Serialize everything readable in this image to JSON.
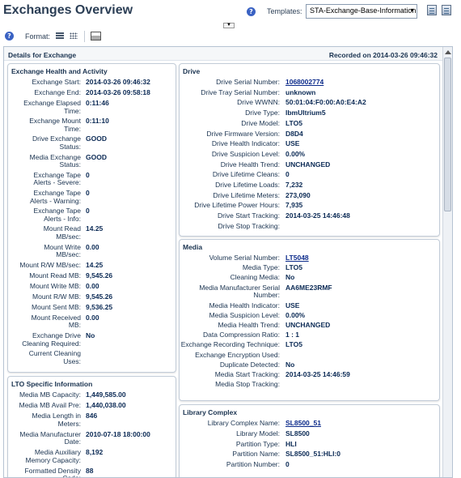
{
  "header": {
    "title": "Exchanges Overview",
    "templates_label": "Templates:",
    "template_value": "STA-Exchange-Base-Information",
    "help_glyph": "?"
  },
  "toolbar": {
    "format_label": "Format:"
  },
  "details": {
    "title": "Details for Exchange",
    "recorded": "Recorded on 2014-03-26 09:46:32"
  },
  "health": {
    "title": "Exchange Health and Activity",
    "rows": [
      {
        "label": [
          "Exchange Start:"
        ],
        "value": "2014-03-26 09:46:32"
      },
      {
        "label": [
          "Exchange End:"
        ],
        "value": "2014-03-26 09:58:18"
      },
      {
        "label": [
          "Exchange Elapsed",
          "Time:"
        ],
        "value": "0:11:46"
      },
      {
        "label": [
          "Exchange Mount",
          "Time:"
        ],
        "value": "0:11:10"
      },
      {
        "label": [
          "Drive Exchange",
          "Status:"
        ],
        "value": "GOOD"
      },
      {
        "label": [
          "Media Exchange",
          "Status:"
        ],
        "value": "GOOD"
      },
      {
        "label": [
          "Exchange Tape",
          "Alerts - Severe:"
        ],
        "value": "0"
      },
      {
        "label": [
          "Exchange Tape",
          "Alerts - Warning:"
        ],
        "value": "0"
      },
      {
        "label": [
          "Exchange Tape",
          "Alerts - Info:"
        ],
        "value": "0"
      },
      {
        "label": [
          "Mount Read",
          "MB/sec:"
        ],
        "value": "14.25"
      },
      {
        "label": [
          "Mount Write",
          "MB/sec:"
        ],
        "value": "0.00"
      },
      {
        "label": [
          "Mount R/W MB/sec:"
        ],
        "value": "14.25"
      },
      {
        "label": [
          "Mount Read MB:"
        ],
        "value": "9,545.26"
      },
      {
        "label": [
          "Mount Write MB:"
        ],
        "value": "0.00"
      },
      {
        "label": [
          "Mount R/W MB:"
        ],
        "value": "9,545.26"
      },
      {
        "label": [
          "Mount Sent MB:"
        ],
        "value": "9,536.25"
      },
      {
        "label": [
          "Mount Received",
          "MB:"
        ],
        "value": "0.00"
      },
      {
        "label": [
          "Exchange Drive",
          "Cleaning Required:"
        ],
        "value": "No"
      },
      {
        "label": [
          "Current Cleaning",
          "Uses:"
        ],
        "value": ""
      }
    ]
  },
  "lto": {
    "title": "LTO Specific Information",
    "rows": [
      {
        "label": [
          "Media MB Capacity:"
        ],
        "value": "1,449,585.00"
      },
      {
        "label": [
          "Media MB Avail Pre:"
        ],
        "value": "1,440,038.00"
      },
      {
        "label": [
          "Media Length in",
          "Meters:"
        ],
        "value": "846"
      },
      {
        "label": [
          "Media Manufacturer",
          "Date:"
        ],
        "value": "2010-07-18 18:00:00"
      },
      {
        "label": [
          "Media Auxiliary",
          "Memory Capacity:"
        ],
        "value": "8,192"
      },
      {
        "label": [
          "Formatted Density",
          "Code:"
        ],
        "value": "88"
      }
    ]
  },
  "drive": {
    "title": "Drive",
    "rows": [
      {
        "label": [
          "Drive Serial Number:"
        ],
        "value": "1068002774",
        "link": true
      },
      {
        "label": [
          "Drive Tray Serial Number:"
        ],
        "value": "unknown"
      },
      {
        "label": [
          "Drive WWNN:"
        ],
        "value": "50:01:04:F0:00:A0:E4:A2"
      },
      {
        "label": [
          "Drive Type:"
        ],
        "value": "IbmUltrium5"
      },
      {
        "label": [
          "Drive Model:"
        ],
        "value": "LTO5"
      },
      {
        "label": [
          "Drive Firmware Version:"
        ],
        "value": "D8D4"
      },
      {
        "label": [
          "Drive Health Indicator:"
        ],
        "value": "USE"
      },
      {
        "label": [
          "Drive Suspicion Level:"
        ],
        "value": "0.00%"
      },
      {
        "label": [
          "Drive Health Trend:"
        ],
        "value": "UNCHANGED"
      },
      {
        "label": [
          "Drive Lifetime Cleans:"
        ],
        "value": "0"
      },
      {
        "label": [
          "Drive Lifetime Loads:"
        ],
        "value": "7,232"
      },
      {
        "label": [
          "Drive Lifetime Meters:"
        ],
        "value": "273,090"
      },
      {
        "label": [
          "Drive Lifetime Power Hours:"
        ],
        "value": "7,935"
      },
      {
        "label": [
          "Drive Start Tracking:"
        ],
        "value": "2014-03-25 14:46:48"
      },
      {
        "label": [
          "Drive Stop Tracking:"
        ],
        "value": ""
      }
    ]
  },
  "media": {
    "title": "Media",
    "rows": [
      {
        "label": [
          "Volume Serial Number:"
        ],
        "value": "LT5048",
        "link": true
      },
      {
        "label": [
          "Media Type:"
        ],
        "value": "LTO5"
      },
      {
        "label": [
          "Cleaning Media:"
        ],
        "value": "No"
      },
      {
        "label": [
          "Media Manufacturer Serial",
          "Number:"
        ],
        "value": "AA6ME23RMF"
      },
      {
        "label": [
          "Media Health Indicator:"
        ],
        "value": "USE"
      },
      {
        "label": [
          "Media Suspicion Level:"
        ],
        "value": "0.00%"
      },
      {
        "label": [
          "Media Health Trend:"
        ],
        "value": "UNCHANGED"
      },
      {
        "label": [
          "Data Compression Ratio:"
        ],
        "value": "1 : 1"
      },
      {
        "label": [
          "Exchange Recording Technique:"
        ],
        "value": "LTO5"
      },
      {
        "label": [
          "Exchange Encryption Used:"
        ],
        "value": ""
      },
      {
        "label": [
          "Duplicate Detected:"
        ],
        "value": "No"
      },
      {
        "label": [
          "Media Start Tracking:"
        ],
        "value": "2014-03-25 14:46:59"
      },
      {
        "label": [
          "Media Stop Tracking:"
        ],
        "value": ""
      }
    ]
  },
  "library": {
    "title": "Library Complex",
    "rows": [
      {
        "label": [
          "Library Complex Name:"
        ],
        "value": "SL8500_51",
        "link": true
      },
      {
        "label": [
          "Library Model:"
        ],
        "value": "SL8500"
      },
      {
        "label": [
          "Partition Type:"
        ],
        "value": "HLI"
      },
      {
        "label": [
          "Partition Name:"
        ],
        "value": "SL8500_51:HLI:0"
      },
      {
        "label": [
          "Partition Number:"
        ],
        "value": "0"
      }
    ]
  }
}
